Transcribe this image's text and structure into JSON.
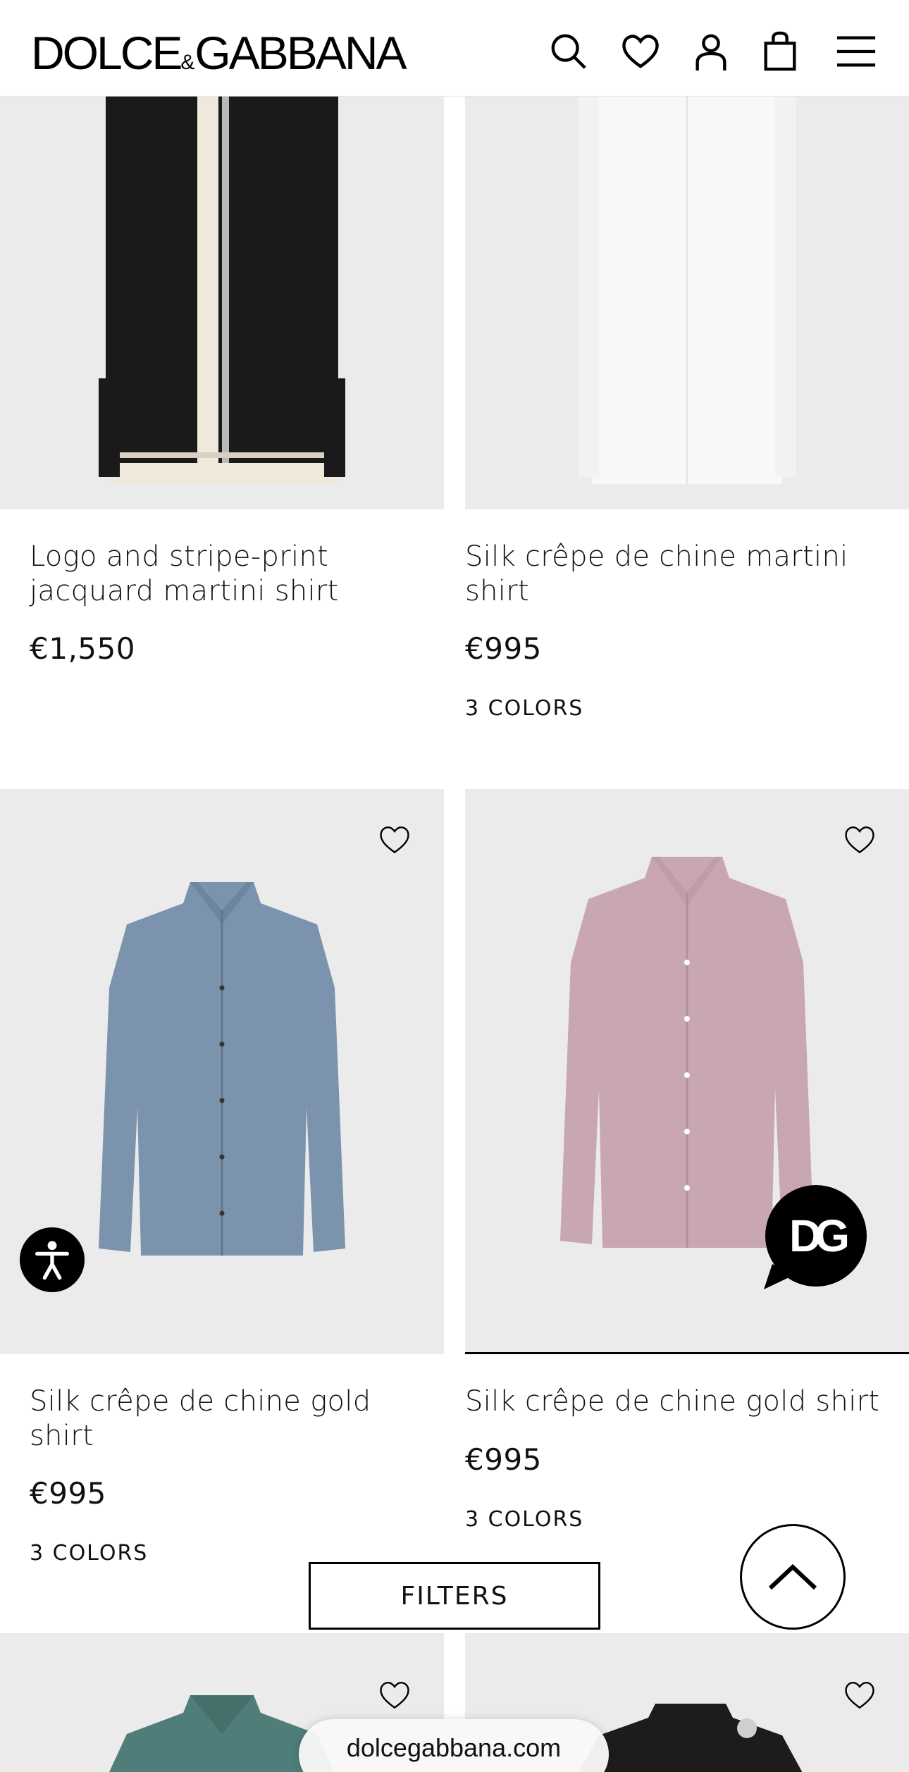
{
  "header": {
    "brand_left": "DOLCE",
    "brand_amp": "&",
    "brand_right": "GABBANA",
    "icons": [
      "search-icon",
      "heart-icon",
      "account-icon",
      "bag-icon",
      "menu-icon"
    ]
  },
  "products": [
    {
      "name_line1": "Logo and stripe-print",
      "name_line2": "jacquard martini shirt",
      "price": "€1,550",
      "colors": "",
      "shirt_color": "#1a1a1a"
    },
    {
      "name_line1": "Silk crêpe de chine martini",
      "name_line2": "shirt",
      "price": "€995",
      "colors": "3 COLORS",
      "shirt_color": "#f8f8f8"
    },
    {
      "name_line1": "Silk crêpe de chine gold",
      "name_line2": "shirt",
      "price": "€995",
      "colors": "3 COLORS",
      "shirt_color": "#7b93ad"
    },
    {
      "name_line1": "Silk crêpe de chine gold shirt",
      "name_line2": "",
      "price": "€995",
      "colors": "3 COLORS",
      "shirt_color": "#c9a7b0"
    },
    {
      "shirt_color": "#4f7d79"
    },
    {
      "shirt_color": "#1c1c1c"
    }
  ],
  "filters_label": "FILTERS",
  "chat_badge": "DG",
  "url": "dolcegabbana.com",
  "colors": {
    "image_bg": "#ebebeb",
    "accent": "#000000"
  }
}
